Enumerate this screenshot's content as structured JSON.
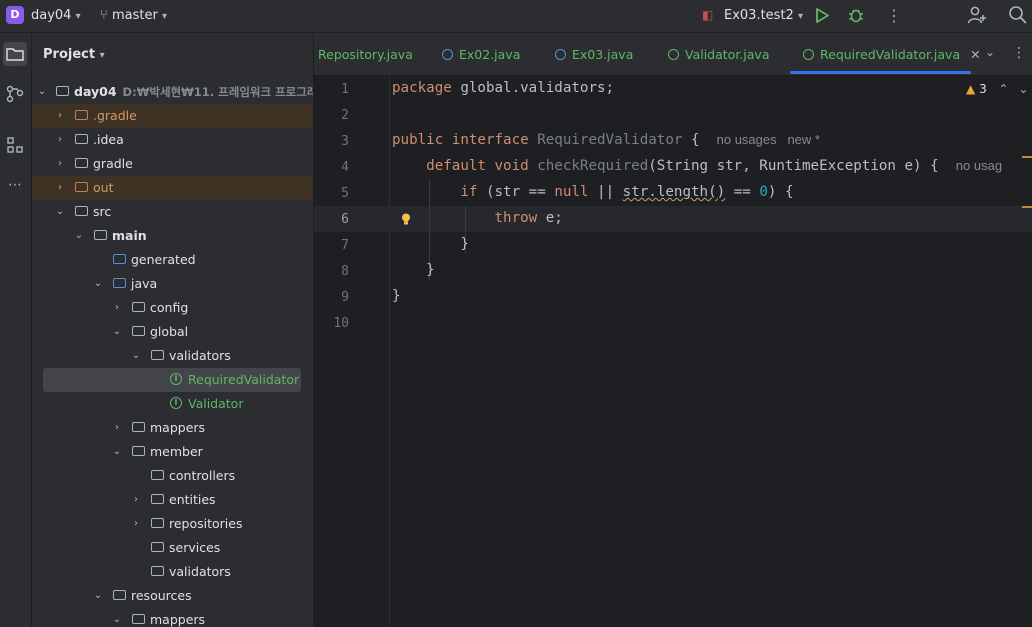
{
  "toolbar": {
    "project_badge": "D",
    "project_name": "day04",
    "branch": "master",
    "run_config": "Ex03.test2"
  },
  "project_panel": {
    "title": "Project",
    "root_name": "day04",
    "root_path": "D:₩박세현₩11. 프레임워크 프로그래",
    "items": [
      {
        "label": ".gradle"
      },
      {
        "label": ".idea"
      },
      {
        "label": "gradle"
      },
      {
        "label": "out"
      },
      {
        "label": "src"
      },
      {
        "label": "main"
      },
      {
        "label": "generated"
      },
      {
        "label": "java"
      },
      {
        "label": "config"
      },
      {
        "label": "global"
      },
      {
        "label": "validators"
      },
      {
        "label": "RequiredValidator"
      },
      {
        "label": "Validator"
      },
      {
        "label": "mappers"
      },
      {
        "label": "member"
      },
      {
        "label": "controllers"
      },
      {
        "label": "entities"
      },
      {
        "label": "repositories"
      },
      {
        "label": "services"
      },
      {
        "label": "validators"
      },
      {
        "label": "resources"
      },
      {
        "label": "mappers"
      }
    ]
  },
  "tabs": [
    {
      "label": "Repository.java"
    },
    {
      "label": "Ex02.java"
    },
    {
      "label": "Ex03.java"
    },
    {
      "label": "Validator.java"
    },
    {
      "label": "RequiredValidator.java"
    }
  ],
  "editor": {
    "warning_count": "3",
    "line_numbers": [
      "1",
      "2",
      "3",
      "4",
      "5",
      "6",
      "7",
      "8",
      "9",
      "10"
    ],
    "code": {
      "l1_kw": "package",
      "l1_rest": " global.validators;",
      "l3_kw": "public interface",
      "l3_name": "RequiredValidator",
      "l3_rest": " {",
      "l3_hint": "no usages   new *",
      "l4_kw": "default void",
      "l4_name": "checkRequired",
      "l4_rest": "(String str, RuntimeException e) {",
      "l4_hint": "no usag",
      "l5_kw": "if",
      "l5_a": " (str == ",
      "l5_null": "null",
      "l5_b": " || ",
      "l5_sq": "str.length()",
      "l5_c": " == ",
      "l5_num": "0",
      "l5_d": ") {",
      "l6_kw": "throw",
      "l6_rest": " e;",
      "l7": "}",
      "l8": "}",
      "l9": "}"
    }
  }
}
